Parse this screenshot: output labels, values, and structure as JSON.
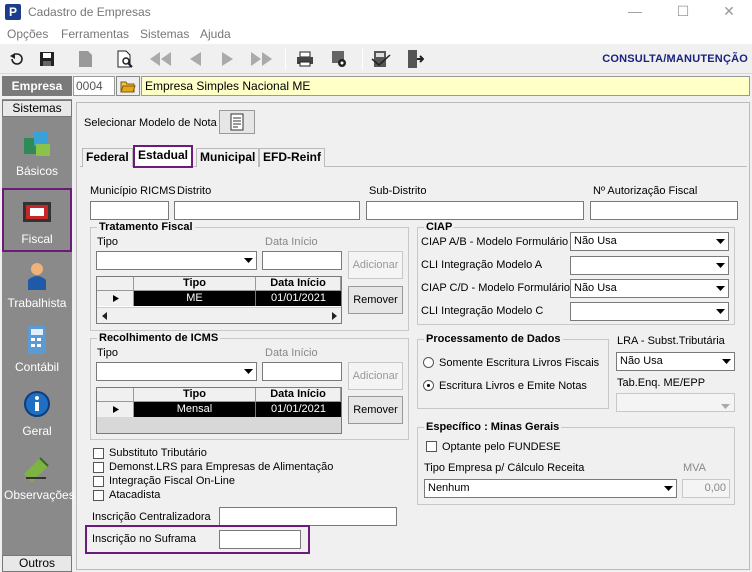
{
  "window": {
    "title": "Cadastro de Empresas",
    "app_icon": "P",
    "minimize": "—",
    "maximize": "☐",
    "close": "✕"
  },
  "menu": [
    "Opções",
    "Ferramentas",
    "Sistemas",
    "Ajuda"
  ],
  "toolbar": {
    "mode": "CONSULTA/MANUTENÇÃO"
  },
  "empresa": {
    "label": "Empresa",
    "code": "0004",
    "name": "Empresa Simples Nacional ME"
  },
  "sidebar": {
    "header": "Sistemas",
    "footer": "Outros",
    "items": [
      {
        "label": "Básicos",
        "icon": "blocks-icon"
      },
      {
        "label": "Fiscal",
        "icon": "register-icon"
      },
      {
        "label": "Trabalhista",
        "icon": "worker-icon"
      },
      {
        "label": "Contábil",
        "icon": "calculator-icon"
      },
      {
        "label": "Geral",
        "icon": "globe-info-icon"
      },
      {
        "label": "Observações",
        "icon": "notes-icon"
      }
    ]
  },
  "main": {
    "model_label": "Selecionar Modelo de Nota",
    "tabs": [
      "Federal",
      "Estadual",
      "Municipal",
      "EFD-Reinf"
    ],
    "active_tab": "Estadual",
    "top_fields": {
      "municipio": "Município RICMS",
      "distrito": "Distrito",
      "subdistrito": "Sub-Distrito",
      "autorizacao": "Nº Autorização Fiscal"
    },
    "tratamento": {
      "title": "Tratamento Fiscal",
      "tipo_label": "Tipo",
      "data_label": "Data Início",
      "add_button": "Adicionar",
      "remove_button": "Remover",
      "columns": [
        "Tipo",
        "Data Início"
      ],
      "rows": [
        {
          "tipo": "ME",
          "data": "01/01/2021"
        }
      ]
    },
    "recolhimento": {
      "title": "Recolhimento de ICMS",
      "tipo_label": "Tipo",
      "data_label": "Data Início",
      "add_button": "Adicionar",
      "remove_button": "Remover",
      "columns": [
        "Tipo",
        "Data Início"
      ],
      "rows": [
        {
          "tipo": "Mensal",
          "data": "01/01/2021"
        }
      ]
    },
    "ciap": {
      "title": "CIAP",
      "rows": [
        {
          "label": "CIAP  A/B - Modelo Formulário",
          "value": "Não Usa"
        },
        {
          "label": "CLI Integração Modelo A",
          "value": ""
        },
        {
          "label": "CIAP C/D - Modelo Formulário",
          "value": "Não Usa"
        },
        {
          "label": "CLI Integração Modelo C",
          "value": ""
        }
      ]
    },
    "processamento": {
      "title": "Processamento de Dados",
      "options": [
        "Somente Escritura Livros Fiscais",
        "Escritura Livros e Emite Notas"
      ],
      "selected_index": 1
    },
    "lra": {
      "label": "LRA - Subst.Tributária",
      "value": "Não Usa",
      "tab_label": "Tab.Enq. ME/EPP"
    },
    "checkboxes": [
      "Substituto Tributário",
      "Demonst.LRS para Empresas de Alimentação",
      "Integração Fiscal On-Line",
      "Atacadista"
    ],
    "inscricao_centralizadora": "Inscrição Centralizadora",
    "inscricao_suframa": "Inscrição no Suframa",
    "minas": {
      "title": "Específico : Minas Gerais",
      "fundese": "Optante pelo FUNDESE",
      "tipo_label": "Tipo Empresa p/ Cálculo Receita",
      "tipo_value": "Nenhum",
      "mva_label": "MVA",
      "mva_value": "0,00"
    }
  }
}
